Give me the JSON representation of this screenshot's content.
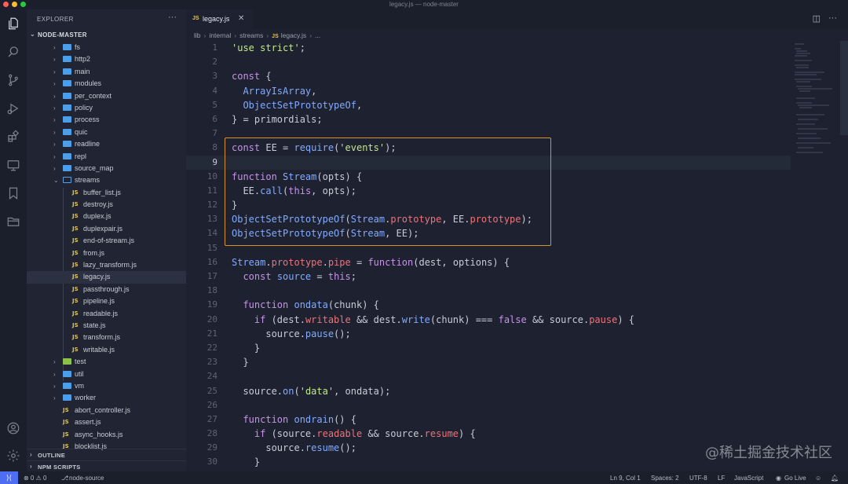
{
  "window": {
    "title": "legacy.js — node-master"
  },
  "sidebar": {
    "header": "EXPLORER",
    "more": "···",
    "root": "NODE-MASTER",
    "tree": [
      {
        "name": "fs",
        "kind": "folder",
        "depth": 1
      },
      {
        "name": "http2",
        "kind": "folder",
        "depth": 1
      },
      {
        "name": "main",
        "kind": "folder",
        "depth": 1
      },
      {
        "name": "modules",
        "kind": "folder",
        "depth": 1
      },
      {
        "name": "per_context",
        "kind": "folder",
        "depth": 1
      },
      {
        "name": "policy",
        "kind": "folder",
        "depth": 1
      },
      {
        "name": "process",
        "kind": "folder",
        "depth": 1
      },
      {
        "name": "quic",
        "kind": "folder",
        "depth": 1
      },
      {
        "name": "readline",
        "kind": "folder",
        "depth": 1
      },
      {
        "name": "repl",
        "kind": "folder",
        "depth": 1
      },
      {
        "name": "source_map",
        "kind": "folder",
        "depth": 1
      },
      {
        "name": "streams",
        "kind": "folder-open",
        "depth": 1
      },
      {
        "name": "buffer_list.js",
        "kind": "js",
        "depth": 2
      },
      {
        "name": "destroy.js",
        "kind": "js",
        "depth": 2
      },
      {
        "name": "duplex.js",
        "kind": "js",
        "depth": 2
      },
      {
        "name": "duplexpair.js",
        "kind": "js",
        "depth": 2
      },
      {
        "name": "end-of-stream.js",
        "kind": "js",
        "depth": 2
      },
      {
        "name": "from.js",
        "kind": "js",
        "depth": 2
      },
      {
        "name": "lazy_transform.js",
        "kind": "js",
        "depth": 2
      },
      {
        "name": "legacy.js",
        "kind": "js",
        "depth": 2,
        "selected": true
      },
      {
        "name": "passthrough.js",
        "kind": "js",
        "depth": 2
      },
      {
        "name": "pipeline.js",
        "kind": "js",
        "depth": 2
      },
      {
        "name": "readable.js",
        "kind": "js",
        "depth": 2
      },
      {
        "name": "state.js",
        "kind": "js",
        "depth": 2
      },
      {
        "name": "transform.js",
        "kind": "js",
        "depth": 2
      },
      {
        "name": "writable.js",
        "kind": "js",
        "depth": 2
      },
      {
        "name": "test",
        "kind": "folder-test",
        "depth": 1
      },
      {
        "name": "util",
        "kind": "folder",
        "depth": 1
      },
      {
        "name": "vm",
        "kind": "folder",
        "depth": 1
      },
      {
        "name": "worker",
        "kind": "folder",
        "depth": 1
      },
      {
        "name": "abort_controller.js",
        "kind": "js",
        "depth": 1
      },
      {
        "name": "assert.js",
        "kind": "js",
        "depth": 1
      },
      {
        "name": "async_hooks.js",
        "kind": "js",
        "depth": 1
      },
      {
        "name": "blocklist.js",
        "kind": "js",
        "depth": 1
      }
    ],
    "sections": [
      "OUTLINE",
      "NPM SCRIPTS"
    ]
  },
  "editor": {
    "tab": {
      "label": "legacy.js",
      "badge": "JS"
    },
    "breadcrumb": [
      "lib",
      "internal",
      "streams",
      "legacy.js",
      "..."
    ],
    "current_line": 9,
    "lines": [
      [
        [
          "s",
          "'use strict'"
        ],
        [
          "p",
          ";"
        ]
      ],
      [],
      [
        [
          "k",
          "const"
        ],
        [
          "p",
          " {"
        ]
      ],
      [
        [
          "p",
          "  "
        ],
        [
          "f",
          "ArrayIsArray"
        ],
        [
          "p",
          ","
        ]
      ],
      [
        [
          "p",
          "  "
        ],
        [
          "f",
          "ObjectSetPrototypeOf"
        ],
        [
          "p",
          ","
        ]
      ],
      [
        [
          "p",
          "} = primordials;"
        ]
      ],
      [],
      [
        [
          "k",
          "const"
        ],
        [
          "p",
          " EE = "
        ],
        [
          "f",
          "require"
        ],
        [
          "p",
          "("
        ],
        [
          "s",
          "'events'"
        ],
        [
          "p",
          ");"
        ]
      ],
      [],
      [
        [
          "k",
          "function"
        ],
        [
          "p",
          " "
        ],
        [
          "f",
          "Stream"
        ],
        [
          "p",
          "(opts) {"
        ]
      ],
      [
        [
          "p",
          "  EE."
        ],
        [
          "f",
          "call"
        ],
        [
          "p",
          "("
        ],
        [
          "k",
          "this"
        ],
        [
          "p",
          ", opts);"
        ]
      ],
      [
        [
          "p",
          "}"
        ]
      ],
      [
        [
          "f",
          "ObjectSetPrototypeOf"
        ],
        [
          "p",
          "("
        ],
        [
          "f",
          "Stream"
        ],
        [
          "p",
          "."
        ],
        [
          "r",
          "prototype"
        ],
        [
          "p",
          ", EE."
        ],
        [
          "r",
          "prototype"
        ],
        [
          "p",
          ");"
        ]
      ],
      [
        [
          "f",
          "ObjectSetPrototypeOf"
        ],
        [
          "p",
          "("
        ],
        [
          "f",
          "Stream"
        ],
        [
          "p",
          ", EE);"
        ]
      ],
      [],
      [
        [
          "f",
          "Stream"
        ],
        [
          "p",
          "."
        ],
        [
          "r",
          "prototype"
        ],
        [
          "p",
          "."
        ],
        [
          "r",
          "pipe"
        ],
        [
          "p",
          " = "
        ],
        [
          "k",
          "function"
        ],
        [
          "p",
          "(dest, options) {"
        ]
      ],
      [
        [
          "p",
          "  "
        ],
        [
          "k",
          "const"
        ],
        [
          "p",
          " "
        ],
        [
          "f",
          "source"
        ],
        [
          "p",
          " = "
        ],
        [
          "k",
          "this"
        ],
        [
          "p",
          ";"
        ]
      ],
      [],
      [
        [
          "p",
          "  "
        ],
        [
          "k",
          "function"
        ],
        [
          "p",
          " "
        ],
        [
          "f",
          "ondata"
        ],
        [
          "p",
          "(chunk) {"
        ]
      ],
      [
        [
          "p",
          "    "
        ],
        [
          "k",
          "if"
        ],
        [
          "p",
          " (dest."
        ],
        [
          "r",
          "writable"
        ],
        [
          "p",
          " && dest."
        ],
        [
          "f",
          "write"
        ],
        [
          "p",
          "(chunk) === "
        ],
        [
          "k",
          "false"
        ],
        [
          "p",
          " && source."
        ],
        [
          "r",
          "pause"
        ],
        [
          "p",
          ") {"
        ]
      ],
      [
        [
          "p",
          "      source."
        ],
        [
          "f",
          "pause"
        ],
        [
          "p",
          "();"
        ]
      ],
      [
        [
          "p",
          "    }"
        ]
      ],
      [
        [
          "p",
          "  }"
        ]
      ],
      [],
      [
        [
          "p",
          "  source."
        ],
        [
          "f",
          "on"
        ],
        [
          "p",
          "("
        ],
        [
          "s",
          "'data'"
        ],
        [
          "p",
          ", ondata);"
        ]
      ],
      [],
      [
        [
          "p",
          "  "
        ],
        [
          "k",
          "function"
        ],
        [
          "p",
          " "
        ],
        [
          "f",
          "ondrain"
        ],
        [
          "p",
          "() {"
        ]
      ],
      [
        [
          "p",
          "    "
        ],
        [
          "k",
          "if"
        ],
        [
          "p",
          " (source."
        ],
        [
          "r",
          "readable"
        ],
        [
          "p",
          " && source."
        ],
        [
          "r",
          "resume"
        ],
        [
          "p",
          ") {"
        ]
      ],
      [
        [
          "p",
          "      source."
        ],
        [
          "f",
          "resume"
        ],
        [
          "p",
          "();"
        ]
      ],
      [
        [
          "p",
          "    }"
        ]
      ]
    ]
  },
  "colors": {
    "keyword": "#c792ea",
    "string": "#c3e88d",
    "function": "#82aaff",
    "property": "#f07178",
    "plain": "#c8ccd6",
    "highlight_box": "#d9922b"
  },
  "statusbar": {
    "problems": "⊗ 0 ⚠ 0",
    "branch": "node-source",
    "position": "Ln 9, Col 1",
    "spaces": "Spaces: 2",
    "encoding": "UTF-8",
    "eol": "LF",
    "language": "JavaScript",
    "golive": "Go Live"
  },
  "watermark": "@稀土掘金技术社区"
}
